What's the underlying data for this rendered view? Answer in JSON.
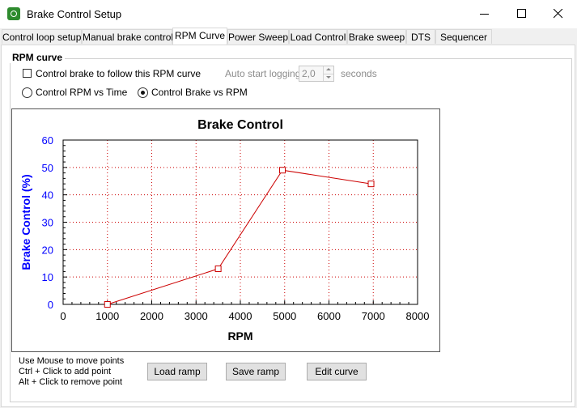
{
  "window": {
    "title": "Brake Control Setup"
  },
  "tabs": [
    {
      "label": "Control loop setup",
      "active": false
    },
    {
      "label": "Manual brake control",
      "active": false
    },
    {
      "label": "RPM Curve",
      "active": true
    },
    {
      "label": "Power Sweep",
      "active": false
    },
    {
      "label": "Load Control",
      "active": false
    },
    {
      "label": "Brake sweep",
      "active": false
    },
    {
      "label": "DTS",
      "active": false
    },
    {
      "label": "Sequencer",
      "active": false
    }
  ],
  "group": {
    "title": "RPM curve",
    "follow_curve_label": "Control brake to follow this RPM curve",
    "follow_curve_checked": false,
    "auto_start_label": "Auto start logging after:",
    "auto_start_value": "2,0",
    "auto_start_unit": "seconds",
    "radio_rpm_time": "Control RPM vs Time",
    "radio_brake_rpm": "Control Brake vs RPM",
    "selected_mode": "Control Brake vs RPM"
  },
  "help": [
    "Use Mouse to move points",
    "Ctrl + Click to add point",
    "Alt + Click to remove point"
  ],
  "buttons": {
    "load_ramp": "Load ramp",
    "save_ramp": "Save ramp",
    "edit_curve": "Edit curve"
  },
  "chart_data": {
    "type": "line",
    "title": "Brake Control",
    "xlabel": "RPM",
    "ylabel": "Brake Control (%)",
    "xlim": [
      0,
      8000
    ],
    "ylim": [
      0,
      60
    ],
    "xticks": [
      0,
      1000,
      2000,
      3000,
      4000,
      5000,
      6000,
      7000,
      8000
    ],
    "yticks": [
      0,
      10,
      20,
      30,
      40,
      50,
      60
    ],
    "grid": true,
    "series": [
      {
        "x": [
          1000,
          3500,
          4950,
          6950
        ],
        "y": [
          0,
          13,
          49,
          44
        ],
        "color": "#cc0000"
      }
    ],
    "colors": {
      "axis_text": "#0000ff",
      "line": "#cc0000",
      "grid": "#cc0000"
    }
  }
}
